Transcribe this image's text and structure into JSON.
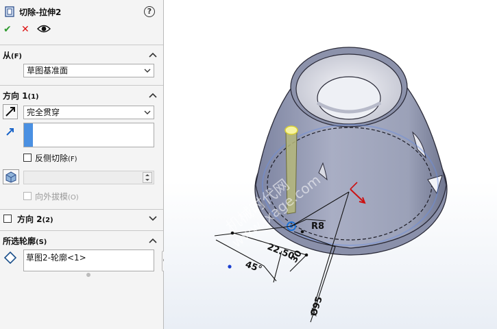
{
  "header": {
    "title": "切除-拉伸2",
    "help": "?",
    "ok": "✔",
    "cancel": "✕"
  },
  "from": {
    "title": "从",
    "shortcut": "(F)",
    "value": "草图基准面"
  },
  "direction1": {
    "title": "方向 1",
    "shortcut": "(1)",
    "end_condition": "完全贯穿",
    "flip_side_label": "反侧切除",
    "flip_side_shortcut": "(F)",
    "draft_outward_label": "向外拔模",
    "draft_outward_shortcut": "(O)"
  },
  "direction2": {
    "title": "方向 2",
    "shortcut": "(2)"
  },
  "selected_contours": {
    "title": "所选轮廓",
    "shortcut": "(S)",
    "items": [
      "草图2-轮廓<1>"
    ]
  },
  "viewport": {
    "dimensions": {
      "radius": "R8",
      "length1": "22.50",
      "length2": "30",
      "angle": "45°",
      "diameter": "Ø95"
    },
    "watermark": {
      "line1": "机械时代网",
      "line2": "www.jxage.com"
    }
  },
  "colors": {
    "body": "#9aa0b8",
    "highlight": "#e8e36a",
    "accent_blue": "#1a64c8",
    "ok_green": "#2f9a2f",
    "cancel_red": "#d11111"
  }
}
